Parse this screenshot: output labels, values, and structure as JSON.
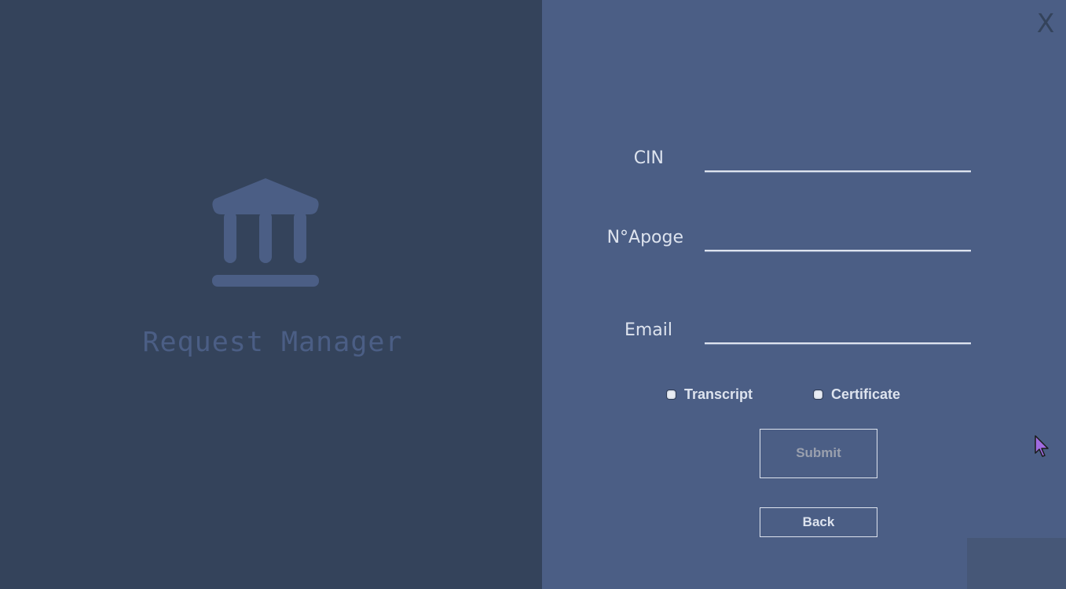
{
  "app": {
    "title": "Request Manager",
    "close_label": "X"
  },
  "form": {
    "cin": {
      "label": "CIN",
      "value": ""
    },
    "apoge": {
      "label": "N°Apoge",
      "value": ""
    },
    "email": {
      "label": "Email",
      "value": ""
    },
    "options": [
      {
        "label": "Transcript",
        "checked": false
      },
      {
        "label": "Certificate",
        "checked": false
      }
    ],
    "submit_label": "Submit",
    "back_label": "Back"
  },
  "icons": {
    "logo": "bank-building-icon",
    "cursor": "mouse-pointer-icon"
  },
  "colors": {
    "left_panel": "#34435b",
    "right_panel": "#4b5e85",
    "text_light": "#dde3ee",
    "disabled_text": "#9aa0ae",
    "cursor": "#a06be0"
  }
}
